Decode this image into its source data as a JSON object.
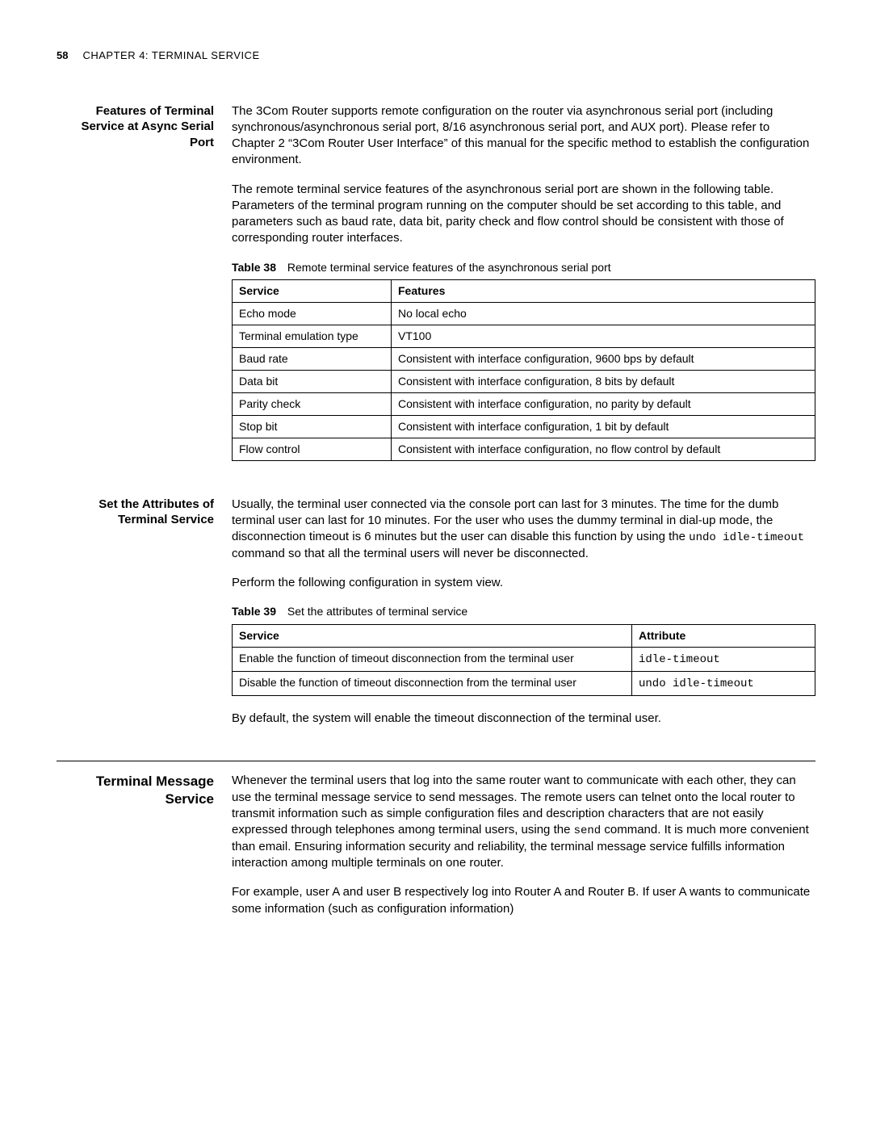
{
  "header": {
    "page_number": "58",
    "chapter": "CHAPTER 4: TERMINAL SERVICE"
  },
  "s1": {
    "title": "Features of Terminal Service at Async Serial Port",
    "p1": "The 3Com Router supports remote configuration on the router via asynchronous serial port (including synchronous/asynchronous serial port, 8/16 asynchronous serial port, and AUX port). Please refer to Chapter 2 “3Com Router User Interface” of this manual for the specific method to establish the configuration environment.",
    "p2": "The remote terminal service features of the asynchronous serial port are shown in the following table. Parameters of the terminal program running on the computer should be set according to this table, and parameters such as baud rate, data bit, parity check and flow control should be consistent with those of corresponding router interfaces.",
    "table_label": "Table 38",
    "table_caption": "Remote terminal service features of the asynchronous serial port",
    "col1": "Service",
    "col2": "Features",
    "rows": [
      {
        "c1": "Echo mode",
        "c2": "No local echo"
      },
      {
        "c1": "Terminal emulation type",
        "c2": "VT100"
      },
      {
        "c1": "Baud rate",
        "c2": "Consistent with interface configuration, 9600 bps by default"
      },
      {
        "c1": "Data bit",
        "c2": "Consistent with interface configuration, 8 bits by default"
      },
      {
        "c1": "Parity check",
        "c2": "Consistent with interface configuration, no parity by default"
      },
      {
        "c1": "Stop bit",
        "c2": "Consistent with interface configuration, 1 bit by default"
      },
      {
        "c1": "Flow control",
        "c2": "Consistent with interface configuration, no flow control by default"
      }
    ]
  },
  "s2": {
    "title": "Set the Attributes of Terminal Service",
    "p1a": "Usually, the terminal user connected via the console port can last for 3 minutes. The time for the dumb terminal user can last for 10 minutes. For the user who uses the dummy terminal in dial-up mode, the disconnection timeout is 6 minutes but the user can disable this function by using the ",
    "cmd1": "undo idle-timeout",
    "p1b": " command so that all the terminal users will never be disconnected.",
    "p2": "Perform the following configuration in system view.",
    "table_label": "Table 39",
    "table_caption": "Set the attributes of terminal service",
    "col1": "Service",
    "col2": "Attribute",
    "rows": [
      {
        "c1": "Enable the function of timeout disconnection from the terminal user",
        "c2": "idle-timeout"
      },
      {
        "c1": "Disable the function of timeout disconnection from the terminal user",
        "c2": "undo idle-timeout"
      }
    ],
    "p3": "By default, the system will enable the timeout disconnection of the terminal user."
  },
  "s3": {
    "title": "Terminal Message Service",
    "p1a": "Whenever the terminal users that log into the same router want to communicate with each other, they can use the terminal message service to send messages. The remote users can telnet onto the local router to transmit information such as simple configuration files and description characters that are not easily expressed through telephones among terminal users, using the ",
    "cmd1": "send",
    "p1b": " command. It is much more convenient than email. Ensuring information security and reliability, the terminal message service fulfills information interaction among multiple terminals on one router.",
    "p2": "For example, user A and user B respectively log into Router A and Router B. If user A wants to communicate some information (such as configuration information)"
  }
}
